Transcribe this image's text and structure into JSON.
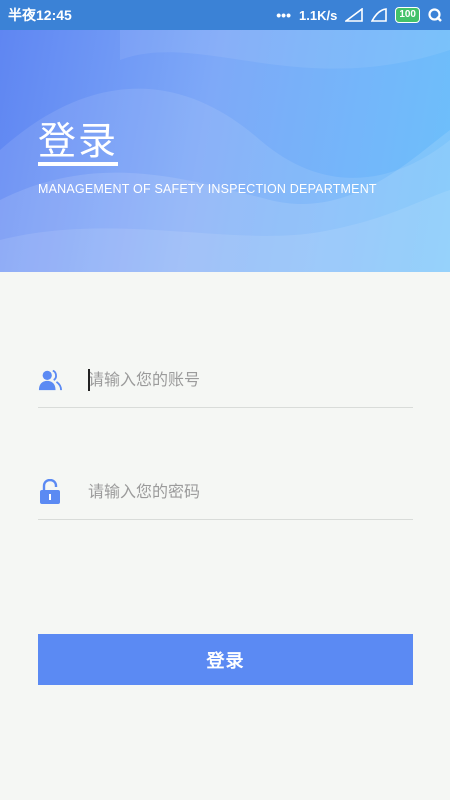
{
  "status_bar": {
    "time": "半夜12:45",
    "network_speed": "1.1K/s",
    "battery": "100",
    "icons": [
      "dots-icon",
      "signal-icon",
      "signal-icon-2",
      "battery-icon",
      "q-icon"
    ]
  },
  "hero": {
    "title": "登录",
    "subtitle": "MANAGEMENT OF SAFETY INSPECTION DEPARTMENT"
  },
  "form": {
    "account_placeholder": "请输入您的账号",
    "password_placeholder": "请输入您的密码"
  },
  "login_button": "登录",
  "colors": {
    "status_bar": "#3b82d6",
    "accent": "#5b8af3",
    "background": "#f5f7f4"
  }
}
